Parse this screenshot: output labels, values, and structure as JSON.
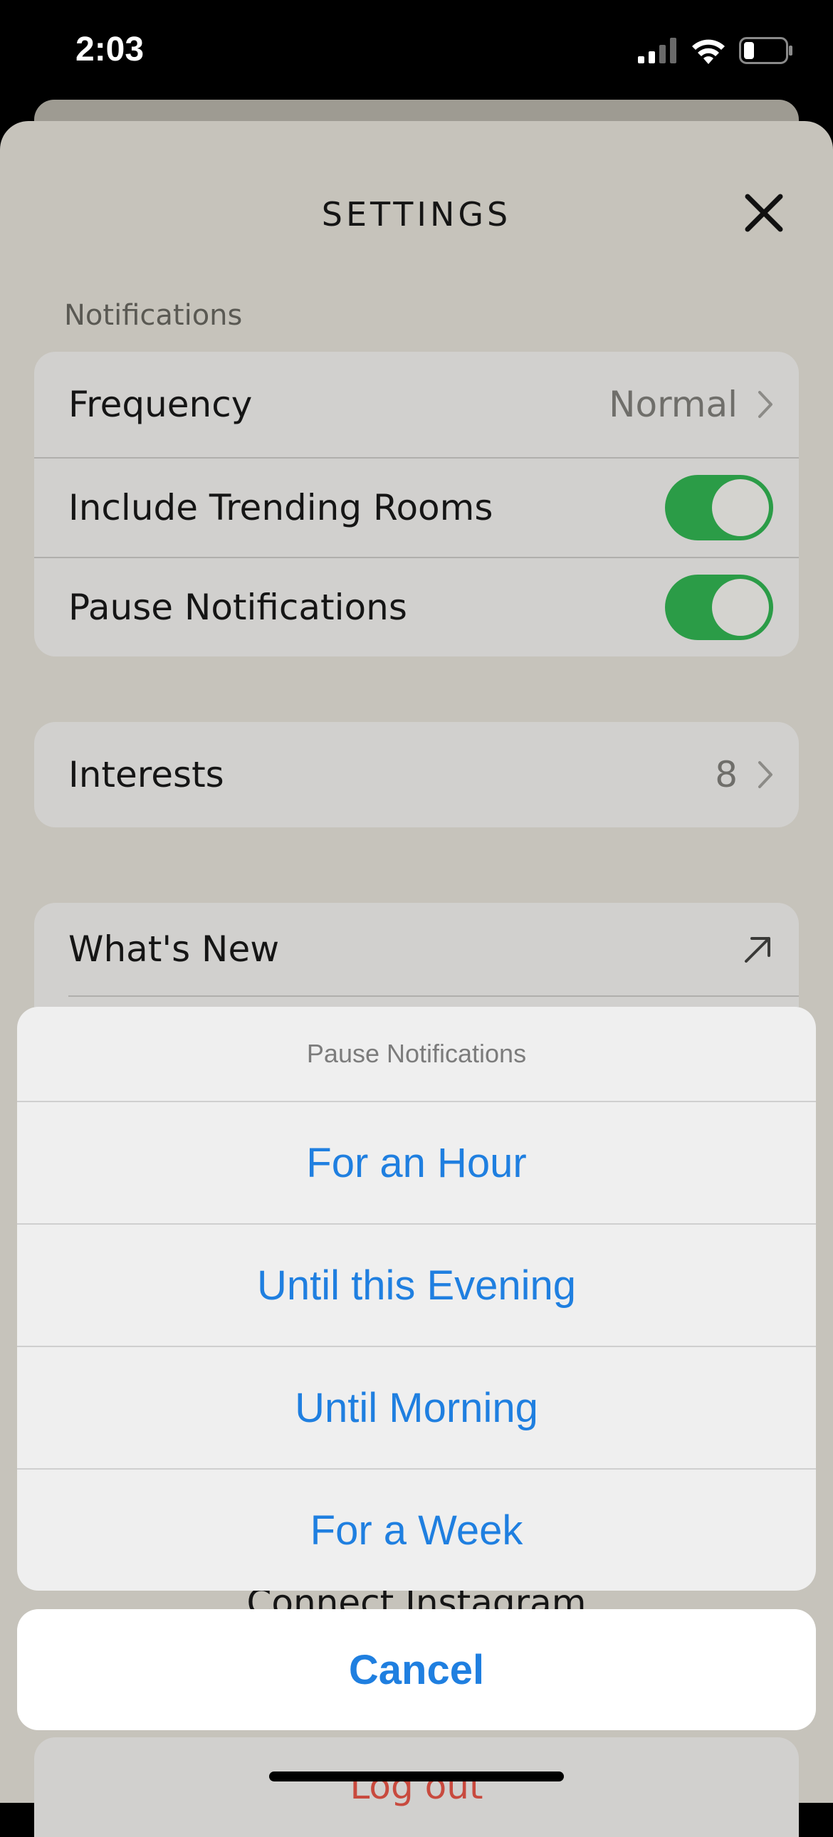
{
  "status_bar": {
    "time": "2:03",
    "battery_level": 0.25
  },
  "icons": {
    "close": "close-icon",
    "chevron": "chevron-right-icon",
    "external": "arrow-up-right-icon",
    "signal": "signal-icon",
    "wifi": "wifi-icon",
    "battery": "battery-icon"
  },
  "header": {
    "title": "SETTINGS"
  },
  "notifications": {
    "section_label": "Notifications",
    "frequency": {
      "label": "Frequency",
      "value": "Normal"
    },
    "trending": {
      "label": "Include Trending Rooms",
      "on": true
    },
    "pause": {
      "label": "Pause Notifications",
      "on": true
    }
  },
  "interests": {
    "label": "Interests",
    "count": "8"
  },
  "whats_new": {
    "label": "What's New"
  },
  "partially_hidden": {
    "connect_instagram": "Connect Instagram",
    "logout": "Log out"
  },
  "action_sheet": {
    "title": "Pause Notifications",
    "options": [
      "For an Hour",
      "Until this Evening",
      "Until Morning",
      "For a Week"
    ],
    "cancel": "Cancel"
  },
  "colors": {
    "accent_blue": "#1f7fe0",
    "toggle_on": "#2b9c47",
    "destructive": "#c84a3e",
    "dim_background": "#c6c3bb"
  }
}
